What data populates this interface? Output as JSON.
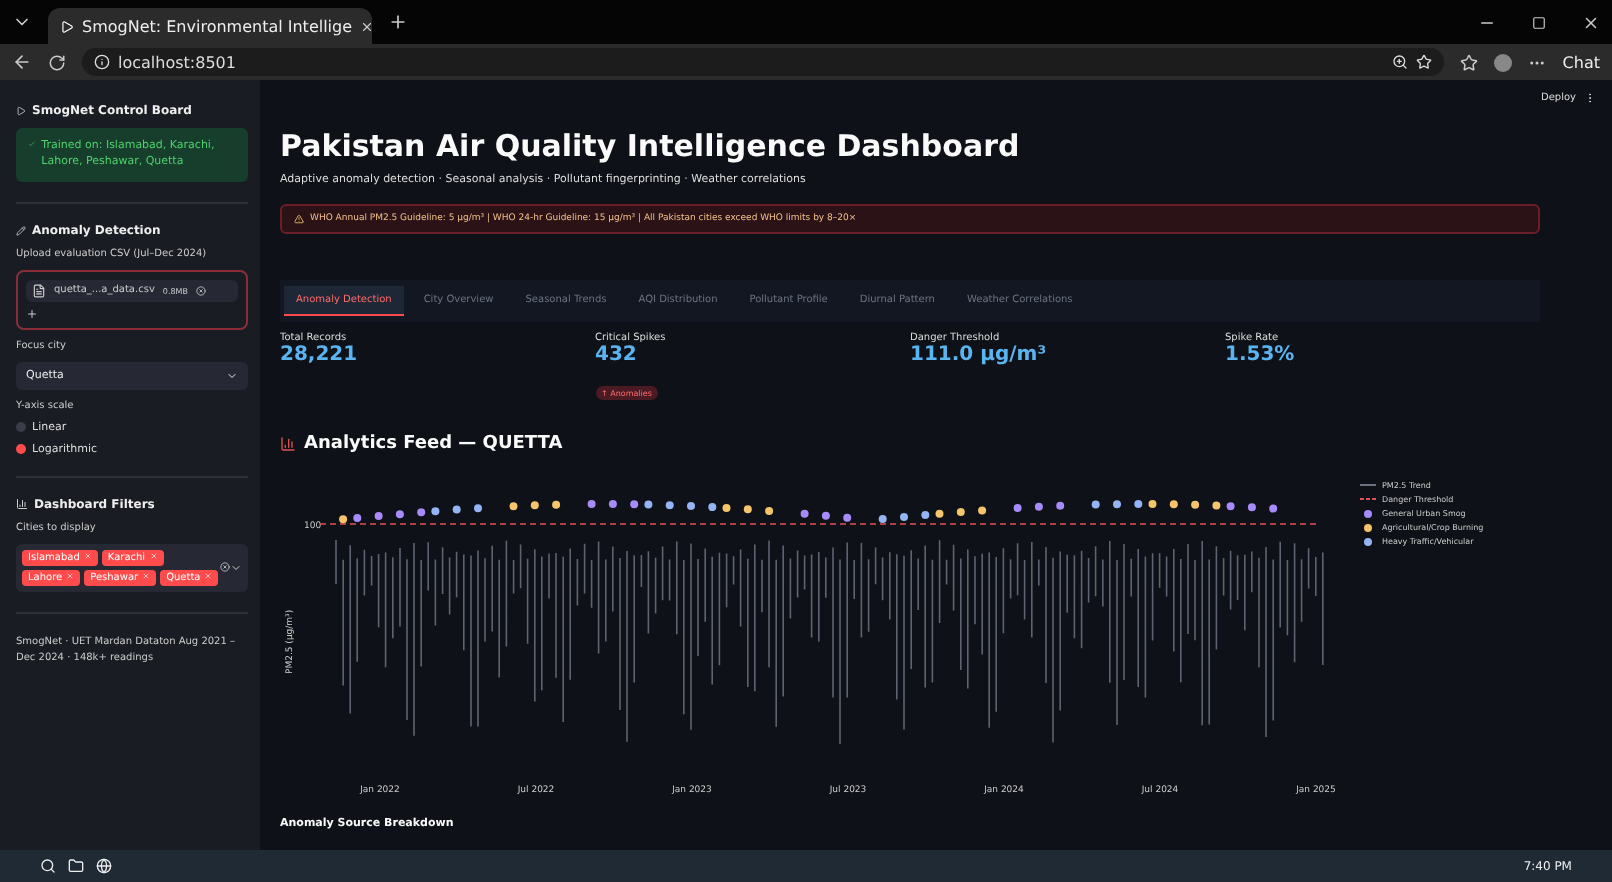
{
  "browser": {
    "tab_title": "SmogNet: Environmental Intellige",
    "url": "localhost:8501",
    "chat_label": "Chat"
  },
  "app_header": {
    "deploy_label": "Deploy"
  },
  "sidebar": {
    "title": "SmogNet Control Board",
    "trained_note": "Trained on: Islamabad, Karachi, Lahore, Peshawar, Quetta",
    "anomaly_section": {
      "title": "Anomaly Detection",
      "upload_label": "Upload evaluation CSV (Jul–Dec 2024)",
      "file_name": "quetta_...a_data.csv",
      "file_size": "0.8MB"
    },
    "focus_city": {
      "label": "Focus city",
      "value": "Quetta"
    },
    "y_axis_scale": {
      "label": "Y-axis scale",
      "options": [
        {
          "label": "Linear",
          "selected": false
        },
        {
          "label": "Logarithmic",
          "selected": true
        }
      ]
    },
    "filters": {
      "title": "Dashboard Filters",
      "cities_label": "Cities to display",
      "cities": [
        "Islamabad",
        "Karachi",
        "Lahore",
        "Peshawar",
        "Quetta"
      ]
    },
    "footer": "SmogNet · UET Mardan Dataton Aug 2021 – Dec 2024 · 148k+ readings"
  },
  "main": {
    "title": "Pakistan Air Quality Intelligence Dashboard",
    "subtitle": "Adaptive anomaly detection · Seasonal analysis · Pollutant fingerprinting · Weather correlations",
    "warning": "WHO Annual PM2.5 Guideline: 5 µg/m³ | WHO 24-hr Guideline: 15 µg/m³ | All Pakistan cities exceed WHO limits by 8–20×",
    "tabs": [
      {
        "label": "Anomaly Detection",
        "selected": true
      },
      {
        "label": "City Overview",
        "selected": false
      },
      {
        "label": "Seasonal Trends",
        "selected": false
      },
      {
        "label": "AQI Distribution",
        "selected": false
      },
      {
        "label": "Pollutant Profile",
        "selected": false
      },
      {
        "label": "Diurnal Pattern",
        "selected": false
      },
      {
        "label": "Weather Correlations",
        "selected": false
      }
    ],
    "metrics": [
      {
        "label": "Total Records",
        "value": "28,221"
      },
      {
        "label": "Critical Spikes",
        "value": "432",
        "badge": "↑ Anomalies"
      },
      {
        "label": "Danger Threshold",
        "value": "111.0 µg/m³"
      },
      {
        "label": "Spike Rate",
        "value": "1.53%"
      }
    ],
    "feed_title": "Analytics Feed — QUETTA",
    "chart": {
      "ylabel": "PM2.5 (µg/m³)",
      "ytick": "100",
      "xticks": [
        "Jan 2022",
        "Jul 2022",
        "Jan 2023",
        "Jul 2023",
        "Jan 2024",
        "Jul 2024",
        "Jan 2025"
      ],
      "legend": [
        {
          "label": "PM2.5 Trend",
          "kind": "line",
          "color": "#6b7280"
        },
        {
          "label": "Danger Threshold",
          "kind": "dash",
          "color": "#e05252"
        },
        {
          "label": "General Urban Smog",
          "kind": "dot",
          "color": "#a78bfa"
        },
        {
          "label": "Agricultural/Crop Burning",
          "kind": "dot",
          "color": "#f6c56b"
        },
        {
          "label": "Heavy Traffic/Vehicular",
          "kind": "dot",
          "color": "#93b4f5"
        }
      ]
    },
    "breakdown_title": "Anomaly Source Breakdown"
  },
  "taskbar": {
    "time": "7:40 PM"
  }
}
